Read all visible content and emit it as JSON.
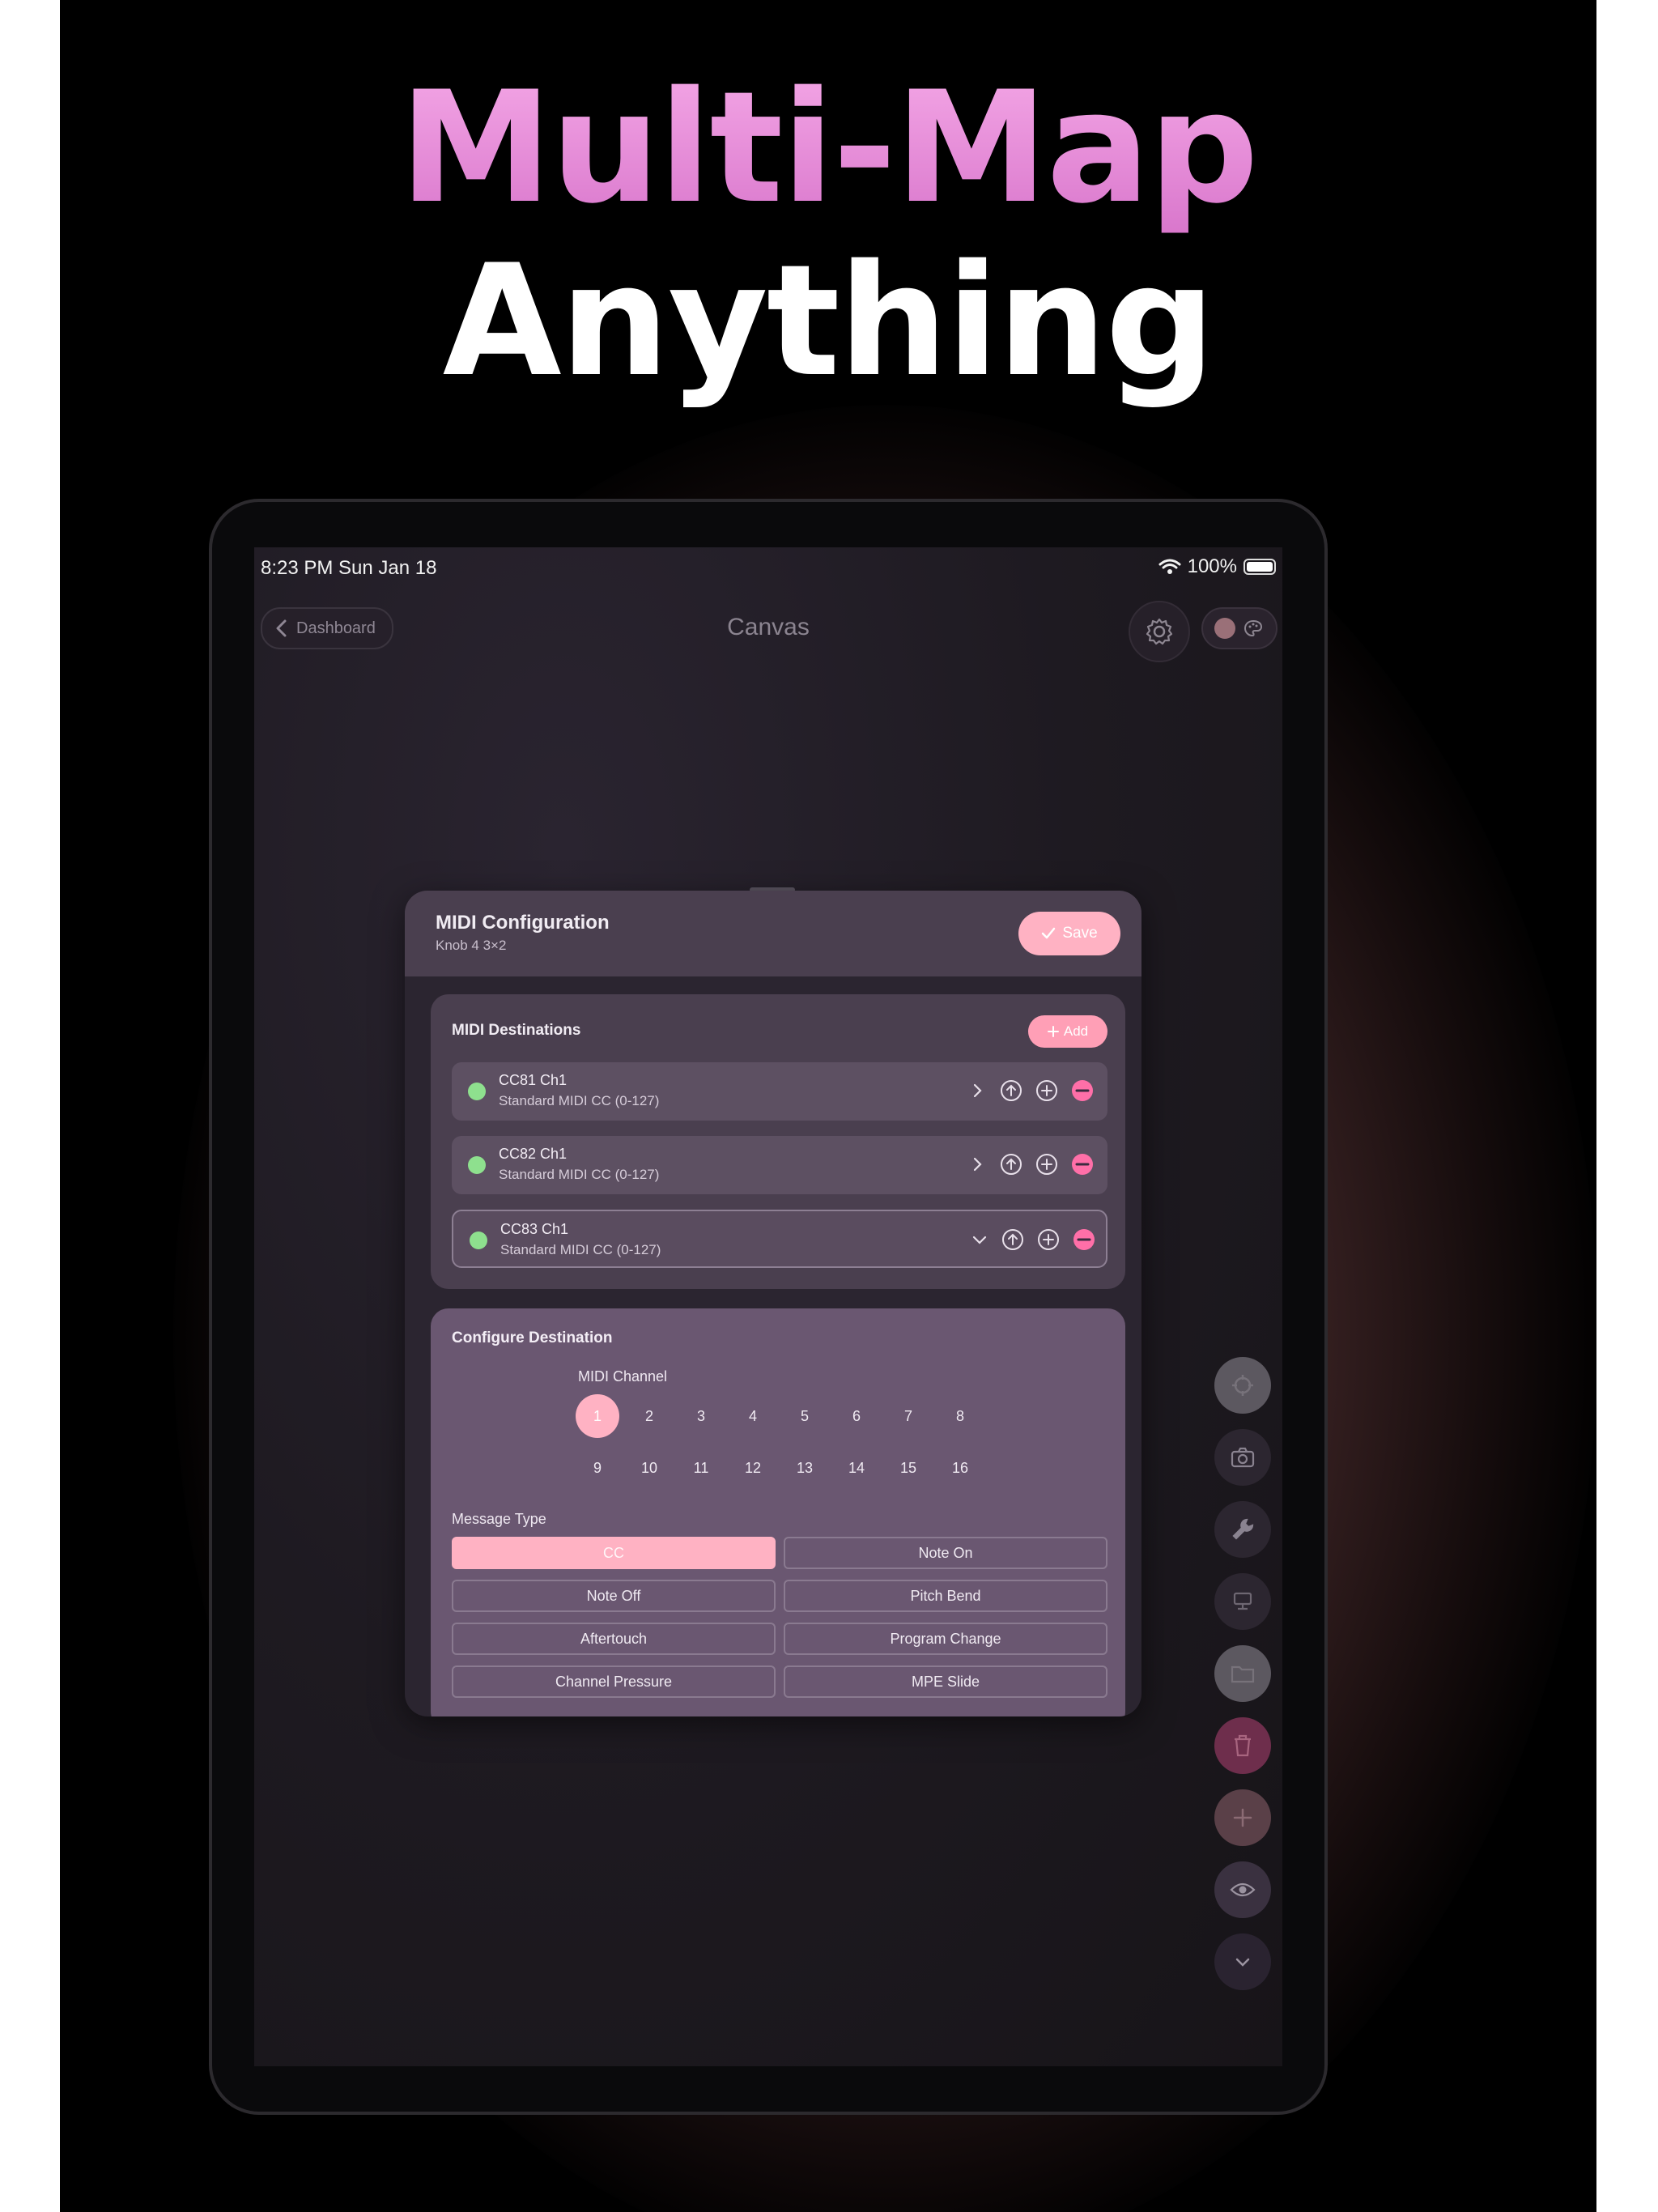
{
  "headline": {
    "line1": "Multi-Map",
    "line2": "Anything"
  },
  "status_bar": {
    "time": "8:23 PM   Sun Jan 18",
    "battery": "100%"
  },
  "nav": {
    "back_label": "Dashboard",
    "title": "Canvas"
  },
  "modal": {
    "title": "MIDI Configuration",
    "subtitle": "Knob 4 3×2",
    "save_label": "Save"
  },
  "destinations": {
    "title": "MIDI Destinations",
    "add_label": "Add",
    "items": [
      {
        "name": "CC81 Ch1",
        "type": "Standard MIDI CC (0-127)",
        "expanded": false
      },
      {
        "name": "CC82 Ch1",
        "type": "Standard MIDI CC (0-127)",
        "expanded": false
      },
      {
        "name": "CC83 Ch1",
        "type": "Standard MIDI CC (0-127)",
        "expanded": true
      }
    ]
  },
  "configure": {
    "title": "Configure Destination",
    "channel_label": "MIDI Channel",
    "channels": [
      "1",
      "2",
      "3",
      "4",
      "5",
      "6",
      "7",
      "8",
      "9",
      "10",
      "11",
      "12",
      "13",
      "14",
      "15",
      "16"
    ],
    "selected_channel": "1",
    "message_type_label": "Message Type",
    "message_types": [
      "CC",
      "Note On",
      "Note Off",
      "Pitch Bend",
      "Aftertouch",
      "Program Change",
      "Channel Pressure",
      "MPE Slide"
    ],
    "selected_message_type": "CC"
  },
  "toolbar": {
    "icons": [
      "target-icon",
      "camera-icon",
      "wrench-icon",
      "monitor-icon",
      "folder-icon",
      "trash-icon",
      "plus-icon",
      "eye-icon",
      "chevron-down-icon"
    ]
  },
  "colors": {
    "accent": "#ffb2c3",
    "status_green": "#8ee08e",
    "remove_pink": "#ff6fa8"
  }
}
